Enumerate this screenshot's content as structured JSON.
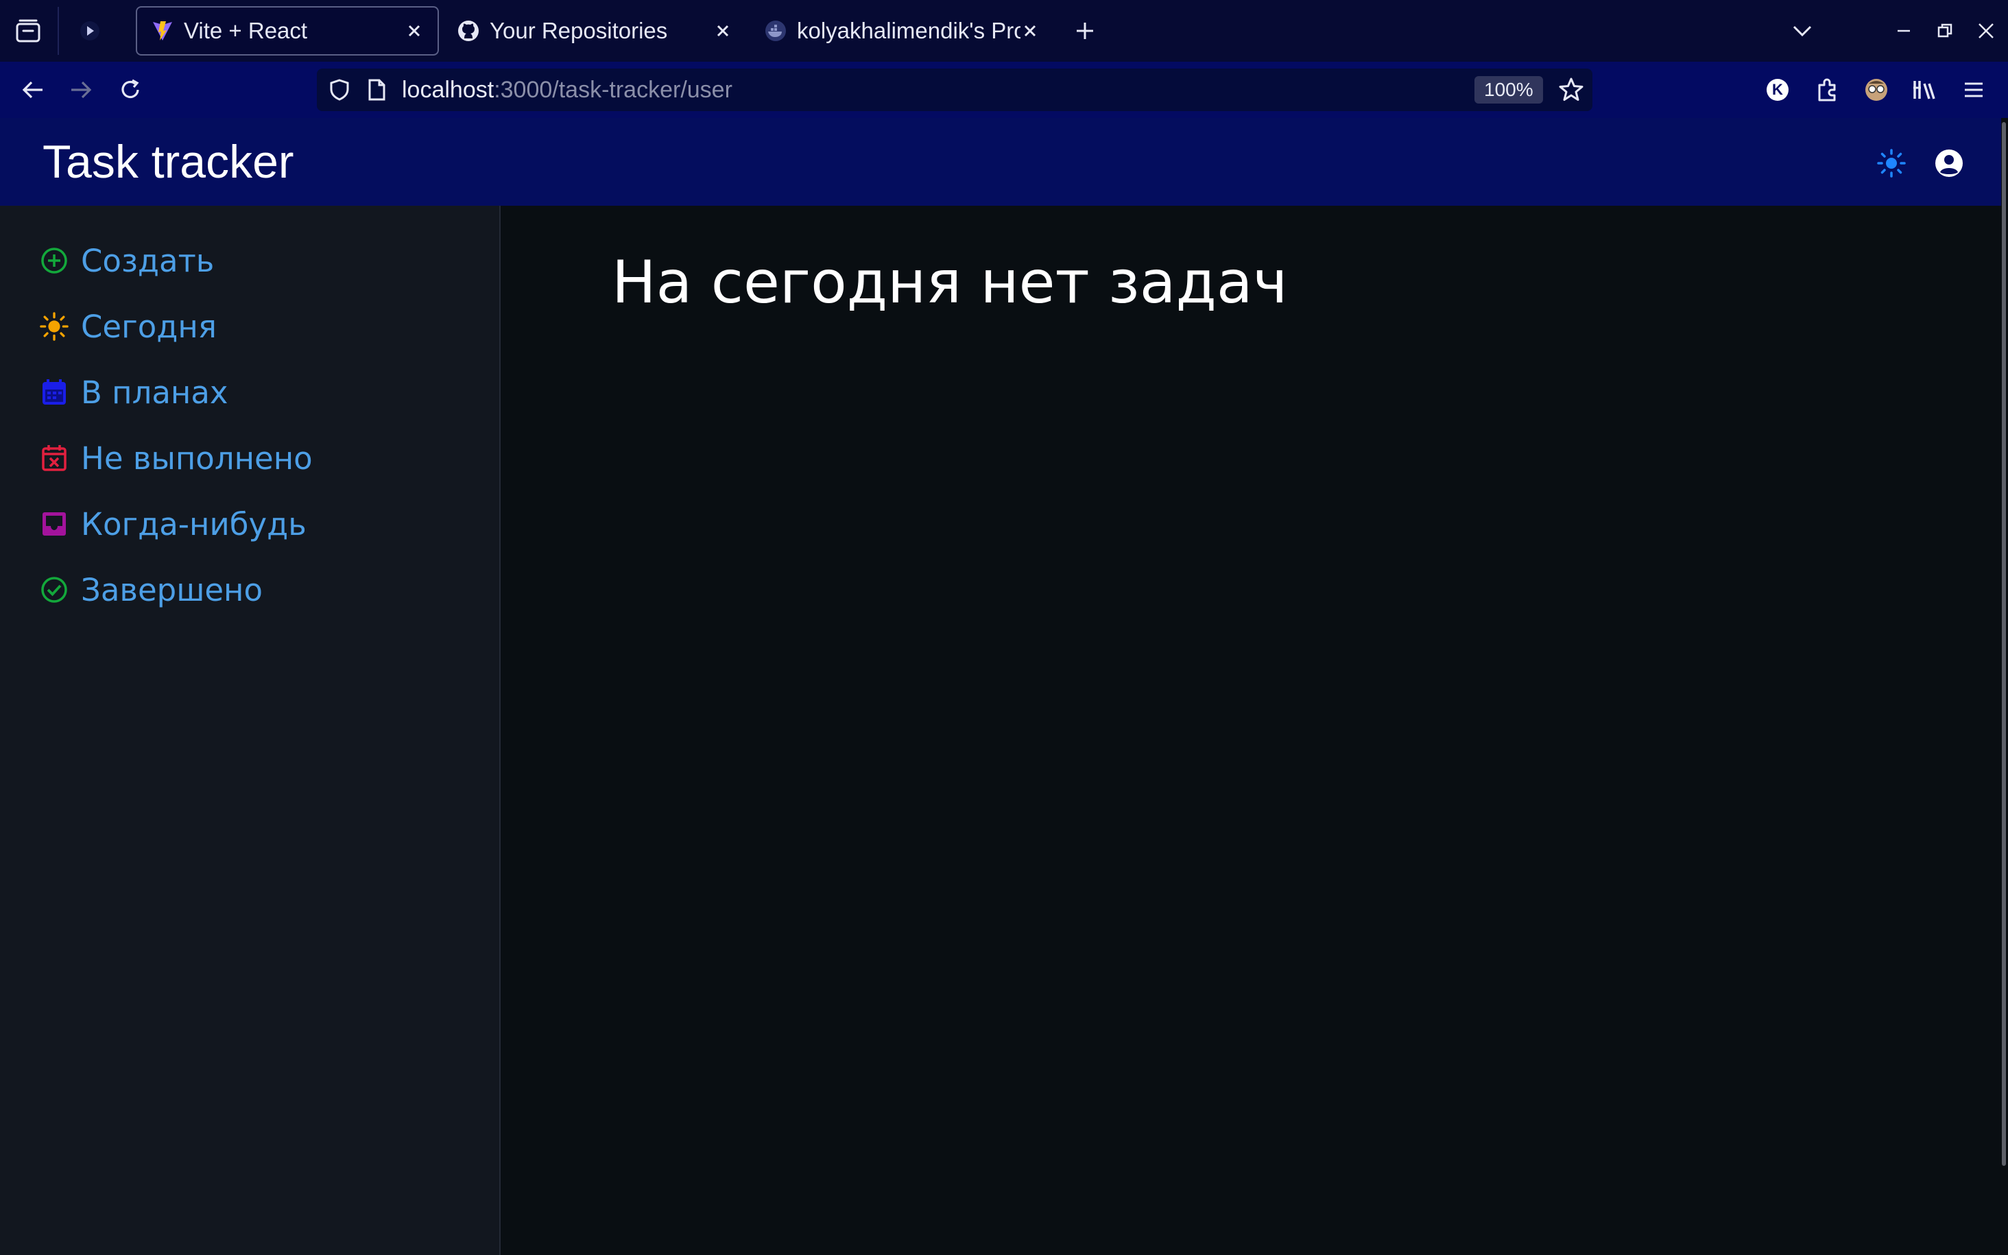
{
  "browser": {
    "tabs": [
      {
        "title": "Vite + React",
        "active": true
      },
      {
        "title": "Your Repositories",
        "active": false
      },
      {
        "title": "kolyakhalimendik's Pro",
        "active": false
      }
    ],
    "url": {
      "host": "localhost",
      "path": ":3000/task-tracker/user"
    },
    "zoom": "100%",
    "extension_badge": "K"
  },
  "app": {
    "title": "Task tracker"
  },
  "sidebar": {
    "items": [
      {
        "label": "Создать",
        "icon": "plus-circle-icon",
        "color": "#13a83b"
      },
      {
        "label": "Сегодня",
        "icon": "sun-icon",
        "color": "#f5a300"
      },
      {
        "label": "В планах",
        "icon": "calendar-icon",
        "color": "#1a1ee8"
      },
      {
        "label": "Не выполнено",
        "icon": "calendar-x-icon",
        "color": "#e2203f"
      },
      {
        "label": "Когда-нибудь",
        "icon": "inbox-icon",
        "color": "#a3139c"
      },
      {
        "label": "Завершено",
        "icon": "check-circle-icon",
        "color": "#13a83b"
      }
    ]
  },
  "main": {
    "empty_message": "На сегодня нет задач"
  },
  "colors": {
    "link": "#4d9fe6",
    "header_bg": "#040d5e",
    "theme_toggle": "#1f86ff"
  }
}
